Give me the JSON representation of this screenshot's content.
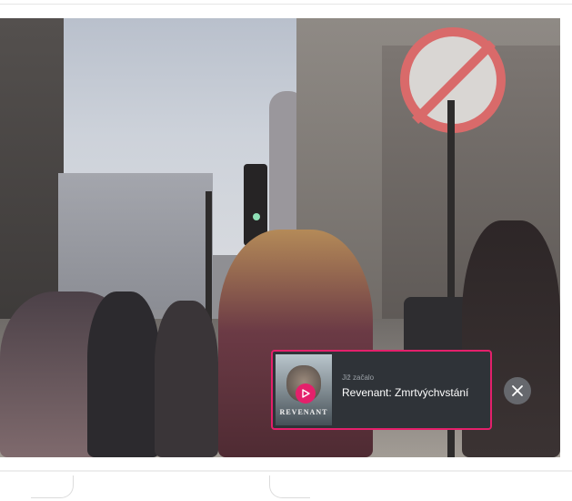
{
  "notification": {
    "subtitle": "Již začalo",
    "title": "Revenant: Zmrtvýchvstání",
    "poster_title": "REVENANT"
  },
  "icons": {
    "play": "play-icon",
    "close": "close-icon"
  },
  "colors": {
    "accent": "#e4206b",
    "card_background": "#2f3338",
    "close_button": "#6e7278"
  }
}
